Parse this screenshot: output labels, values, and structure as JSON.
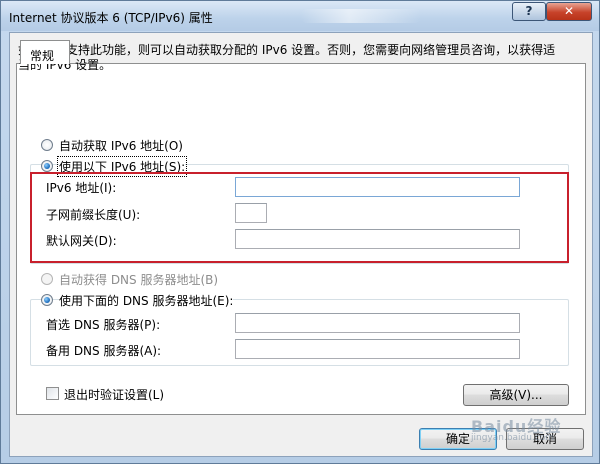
{
  "window": {
    "title": "Internet 协议版本 6 (TCP/IPv6) 属性",
    "help_glyph": "?",
    "close_glyph": "✕"
  },
  "tabs": {
    "general": "常规"
  },
  "description": "如果网络支持此功能，则可以自动获取分配的 IPv6 设置。否则，您需要向网络管理员咨询，以获得适当的 IPv6 设置。",
  "ip_section": {
    "auto_label": "自动获取 IPv6 地址(O)",
    "manual_label": "使用以下 IPv6 地址(S):",
    "selected": "manual",
    "fields": [
      {
        "label": "IPv6 地址(I):",
        "value": ""
      },
      {
        "label": "子网前缀长度(U):",
        "value": ""
      },
      {
        "label": "默认网关(D):",
        "value": ""
      }
    ]
  },
  "dns_section": {
    "auto_label": "自动获得 DNS 服务器地址(B)",
    "manual_label": "使用下面的 DNS 服务器地址(E):",
    "selected": "manual",
    "fields": [
      {
        "label": "首选 DNS 服务器(P):",
        "value": ""
      },
      {
        "label": "备用 DNS 服务器(A):",
        "value": ""
      }
    ]
  },
  "validate_label": "退出时验证设置(L)",
  "validate_checked": false,
  "buttons": {
    "advanced": "高级(V)...",
    "ok": "确定",
    "cancel": "取消"
  },
  "watermark": {
    "text": "Baidu经验",
    "sub": "jingyan.baidu.com"
  },
  "colors": {
    "highlight": "#c8202c",
    "accent": "#3c7fb1"
  }
}
